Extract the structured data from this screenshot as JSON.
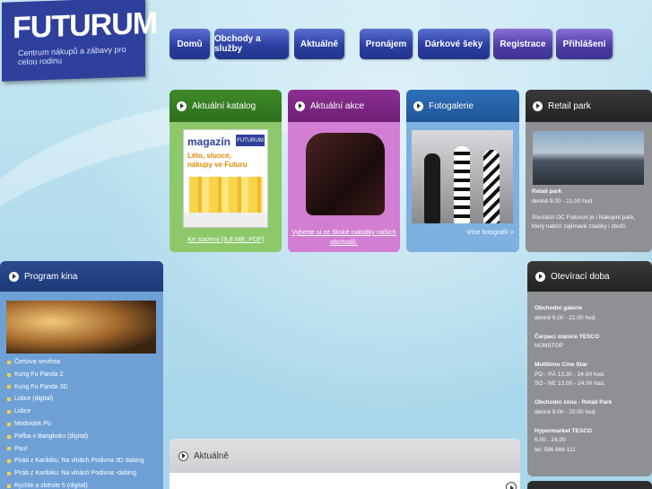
{
  "logo": {
    "name": "FUTURUM",
    "tagline": "Centrum nákupů a zábavy pro celou rodinu"
  },
  "nav": [
    {
      "label": "Domů"
    },
    {
      "label": "Obchody a služby"
    },
    {
      "label": "Aktuálně"
    },
    {
      "label": "Pronájem"
    },
    {
      "label": "Dárkové šeky"
    },
    {
      "label": "Registrace"
    },
    {
      "label": "Přihlášení"
    }
  ],
  "katalog": {
    "title": "Aktuální katalog",
    "cover_title": "magazín",
    "cover_logo": "FUTURUM",
    "cover_text": "Léto, slunce, nákupy ve Futuru",
    "link": "Ke stažení (9,8 MB, PDF)"
  },
  "akce": {
    "title": "Aktuální akce",
    "link": "Vyberte si ze škské nabídky našich obchodů."
  },
  "foto": {
    "title": "Fotogalerie",
    "link": "Více fotografií >"
  },
  "retail": {
    "title": "Retail park",
    "name": "Retail park",
    "hours": "denně 9.00 - 21.00 hod.",
    "desc": "Součástí OC Futurum je i Nákupní park, který nabízí zajímavé značky i zboží."
  },
  "kino": {
    "title": "Program kina",
    "movies": [
      "Čertova nevěsta",
      "Kung Fu Panda 2",
      "Kung Fu Panda 3D",
      "Lidice (digital)",
      "Lidice",
      "Medvídek Pú",
      "Pařba v Bangkoku (digital)",
      "Paul",
      "Piráti z Karibiku: Na vlnách Podivna 3D dabing",
      "Piráti z Karibiku: Na vlnách Podivna -dabing",
      "Rychle a zběsile 5 (digital)"
    ]
  },
  "hours": {
    "title": "Otevírací doba",
    "galerie_label": "Obchodní galerie",
    "galerie_time": "denně 9.00 - 21.00 hod.",
    "tesco_station_label": "Čerpací stanice TESCO",
    "tesco_station_time": "NONSTOP",
    "cinema_label": "Multikino Cine Star",
    "cinema_time1": "PO - PÁ 13.30 - 24.00 hod.",
    "cinema_time2": "SO - NE 12.00 - 24.00 hod.",
    "retail_label": "Obchodní zóna - Retail Park",
    "retail_time": "denně 9.00 - 20.00 hod.",
    "hyper_label": "Hypermarket TESCO",
    "hyper_time": "6.00 - 24.00",
    "hyper_tel": "tel: 596 666 111"
  },
  "news": {
    "title": "Aktuálně"
  }
}
